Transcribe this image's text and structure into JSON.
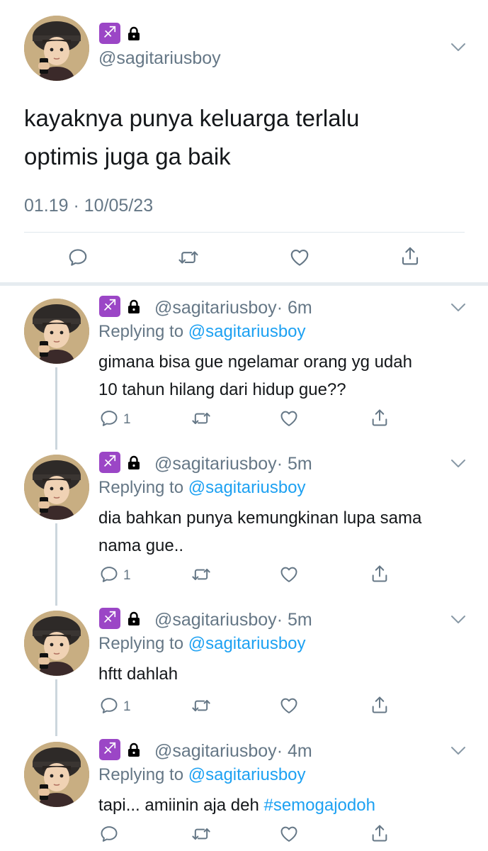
{
  "main_tweet": {
    "handle": "@sagitariusboy",
    "text_line1": "kayaknya punya keluarga terlalu",
    "text_line2": "optimis juga ga baik",
    "timestamp": "01.19 · 10/05/23",
    "sign_glyph": "♐"
  },
  "replies": [
    {
      "handle": "@sagitariusboy",
      "time": "· 6m",
      "replying_prefix": "Replying to",
      "replying_to": "@sagitariusboy",
      "line1": "gimana bisa gue ngelamar orang yg udah",
      "line2": "10 tahun hilang dari hidup gue??",
      "reply_count": "1"
    },
    {
      "handle": "@sagitariusboy",
      "time": "· 5m",
      "replying_prefix": "Replying to",
      "replying_to": "@sagitariusboy",
      "line1": "dia bahkan punya kemungkinan lupa sama",
      "line2": "nama gue..",
      "reply_count": "1"
    },
    {
      "handle": "@sagitariusboy",
      "time": "· 5m",
      "replying_prefix": "Replying to",
      "replying_to": "@sagitariusboy",
      "line1": "hftt dahlah",
      "reply_count": "1"
    },
    {
      "handle": "@sagitariusboy",
      "time": "· 4m",
      "replying_prefix": "Replying to",
      "replying_to": "@sagitariusboy",
      "line1_plain": "tapi... amiinin aja deh ",
      "line1_hashtag": "#semogajodoh"
    }
  ],
  "colors": {
    "accent": "#1da1f2",
    "secondary_text": "#657786",
    "primary_text": "#14171a",
    "sign_badge": "#9b46c6",
    "divider": "#e1e8ed"
  },
  "icons": [
    "reply-icon",
    "retweet-icon",
    "like-icon",
    "share-icon",
    "lock-icon",
    "chevron-down-icon",
    "sagittarius-sign-icon"
  ]
}
